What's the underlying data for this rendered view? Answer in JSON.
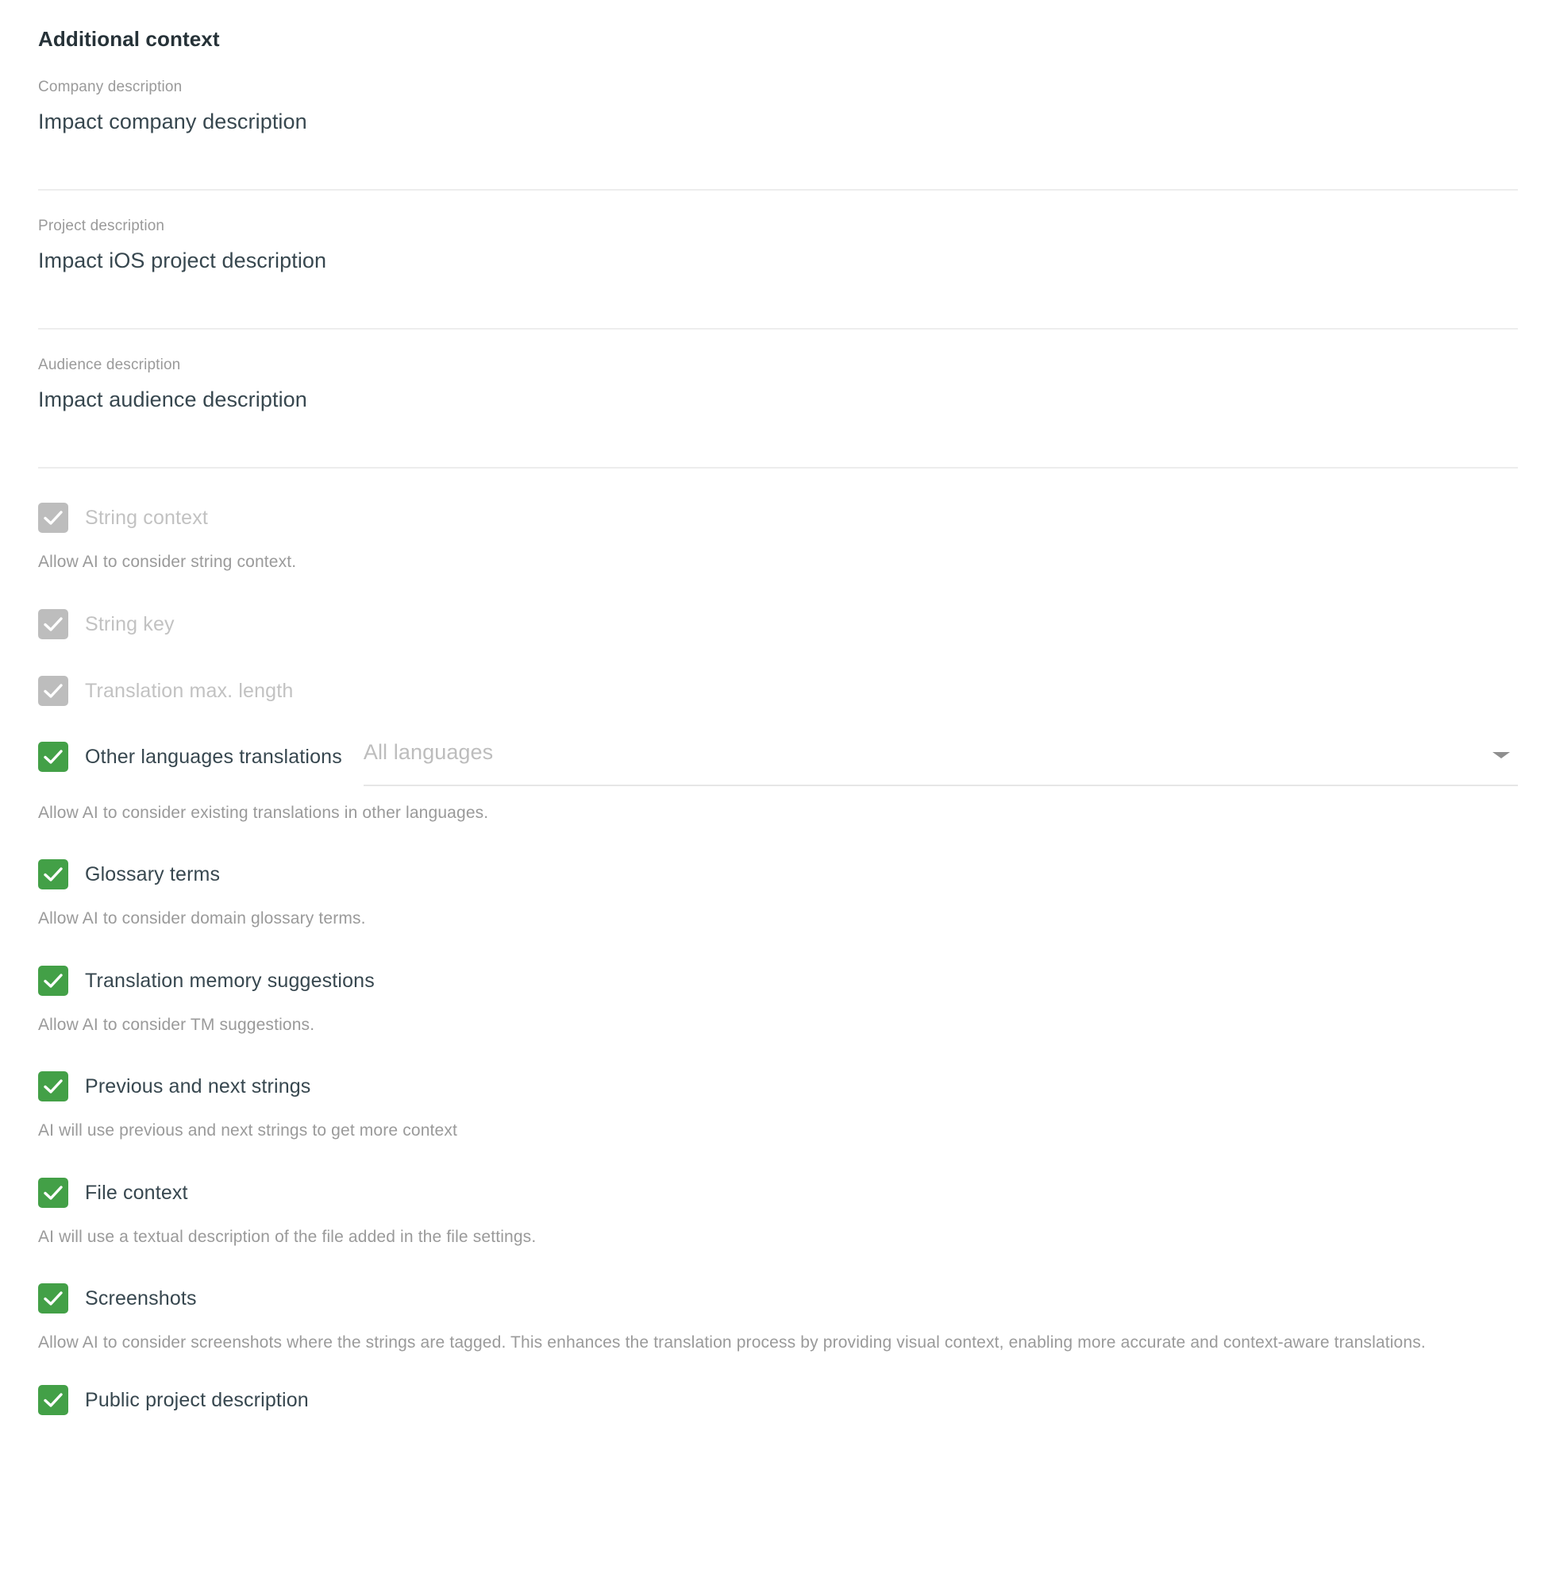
{
  "panel": {
    "title": "Additional context"
  },
  "descriptions": [
    {
      "label": "Company description",
      "value": "Impact company description"
    },
    {
      "label": "Project description",
      "value": "Impact iOS project description"
    },
    {
      "label": "Audience description",
      "value": "Impact audience description"
    }
  ],
  "options": [
    {
      "label": "String context",
      "hint": "Allow AI to consider string context.",
      "checked": true,
      "disabled": true
    },
    {
      "label": "String key",
      "hint": "",
      "checked": true,
      "disabled": true
    },
    {
      "label": "Translation max. length",
      "hint": "",
      "checked": true,
      "disabled": true
    },
    {
      "label": "Other languages translations",
      "hint": "Allow AI to consider existing translations in other languages.",
      "checked": true,
      "disabled": false,
      "select": {
        "value": "All languages",
        "placeholder": "All languages"
      }
    },
    {
      "label": "Glossary terms",
      "hint": "Allow AI to consider domain glossary terms.",
      "checked": true,
      "disabled": false
    },
    {
      "label": "Translation memory suggestions",
      "hint": "Allow AI to consider TM suggestions.",
      "checked": true,
      "disabled": false
    },
    {
      "label": "Previous and next strings",
      "hint": "AI will use previous and next strings to get more context",
      "checked": true,
      "disabled": false
    },
    {
      "label": "File context",
      "hint": "AI will use a textual description of the file added in the file settings.",
      "checked": true,
      "disabled": false
    },
    {
      "label": "Screenshots",
      "hint": "Allow AI to consider screenshots where the strings are tagged. This enhances the translation process by providing visual context, enabling more accurate and context-aware translations.",
      "checked": true,
      "disabled": false
    },
    {
      "label": "Public project description",
      "hint": "",
      "checked": true,
      "disabled": false
    }
  ],
  "colors": {
    "checkbox_on": "#43a047",
    "checkbox_off": "#bdbdbd",
    "text_primary": "#37474f",
    "text_muted": "#9a9a9a",
    "divider": "#ededed"
  }
}
